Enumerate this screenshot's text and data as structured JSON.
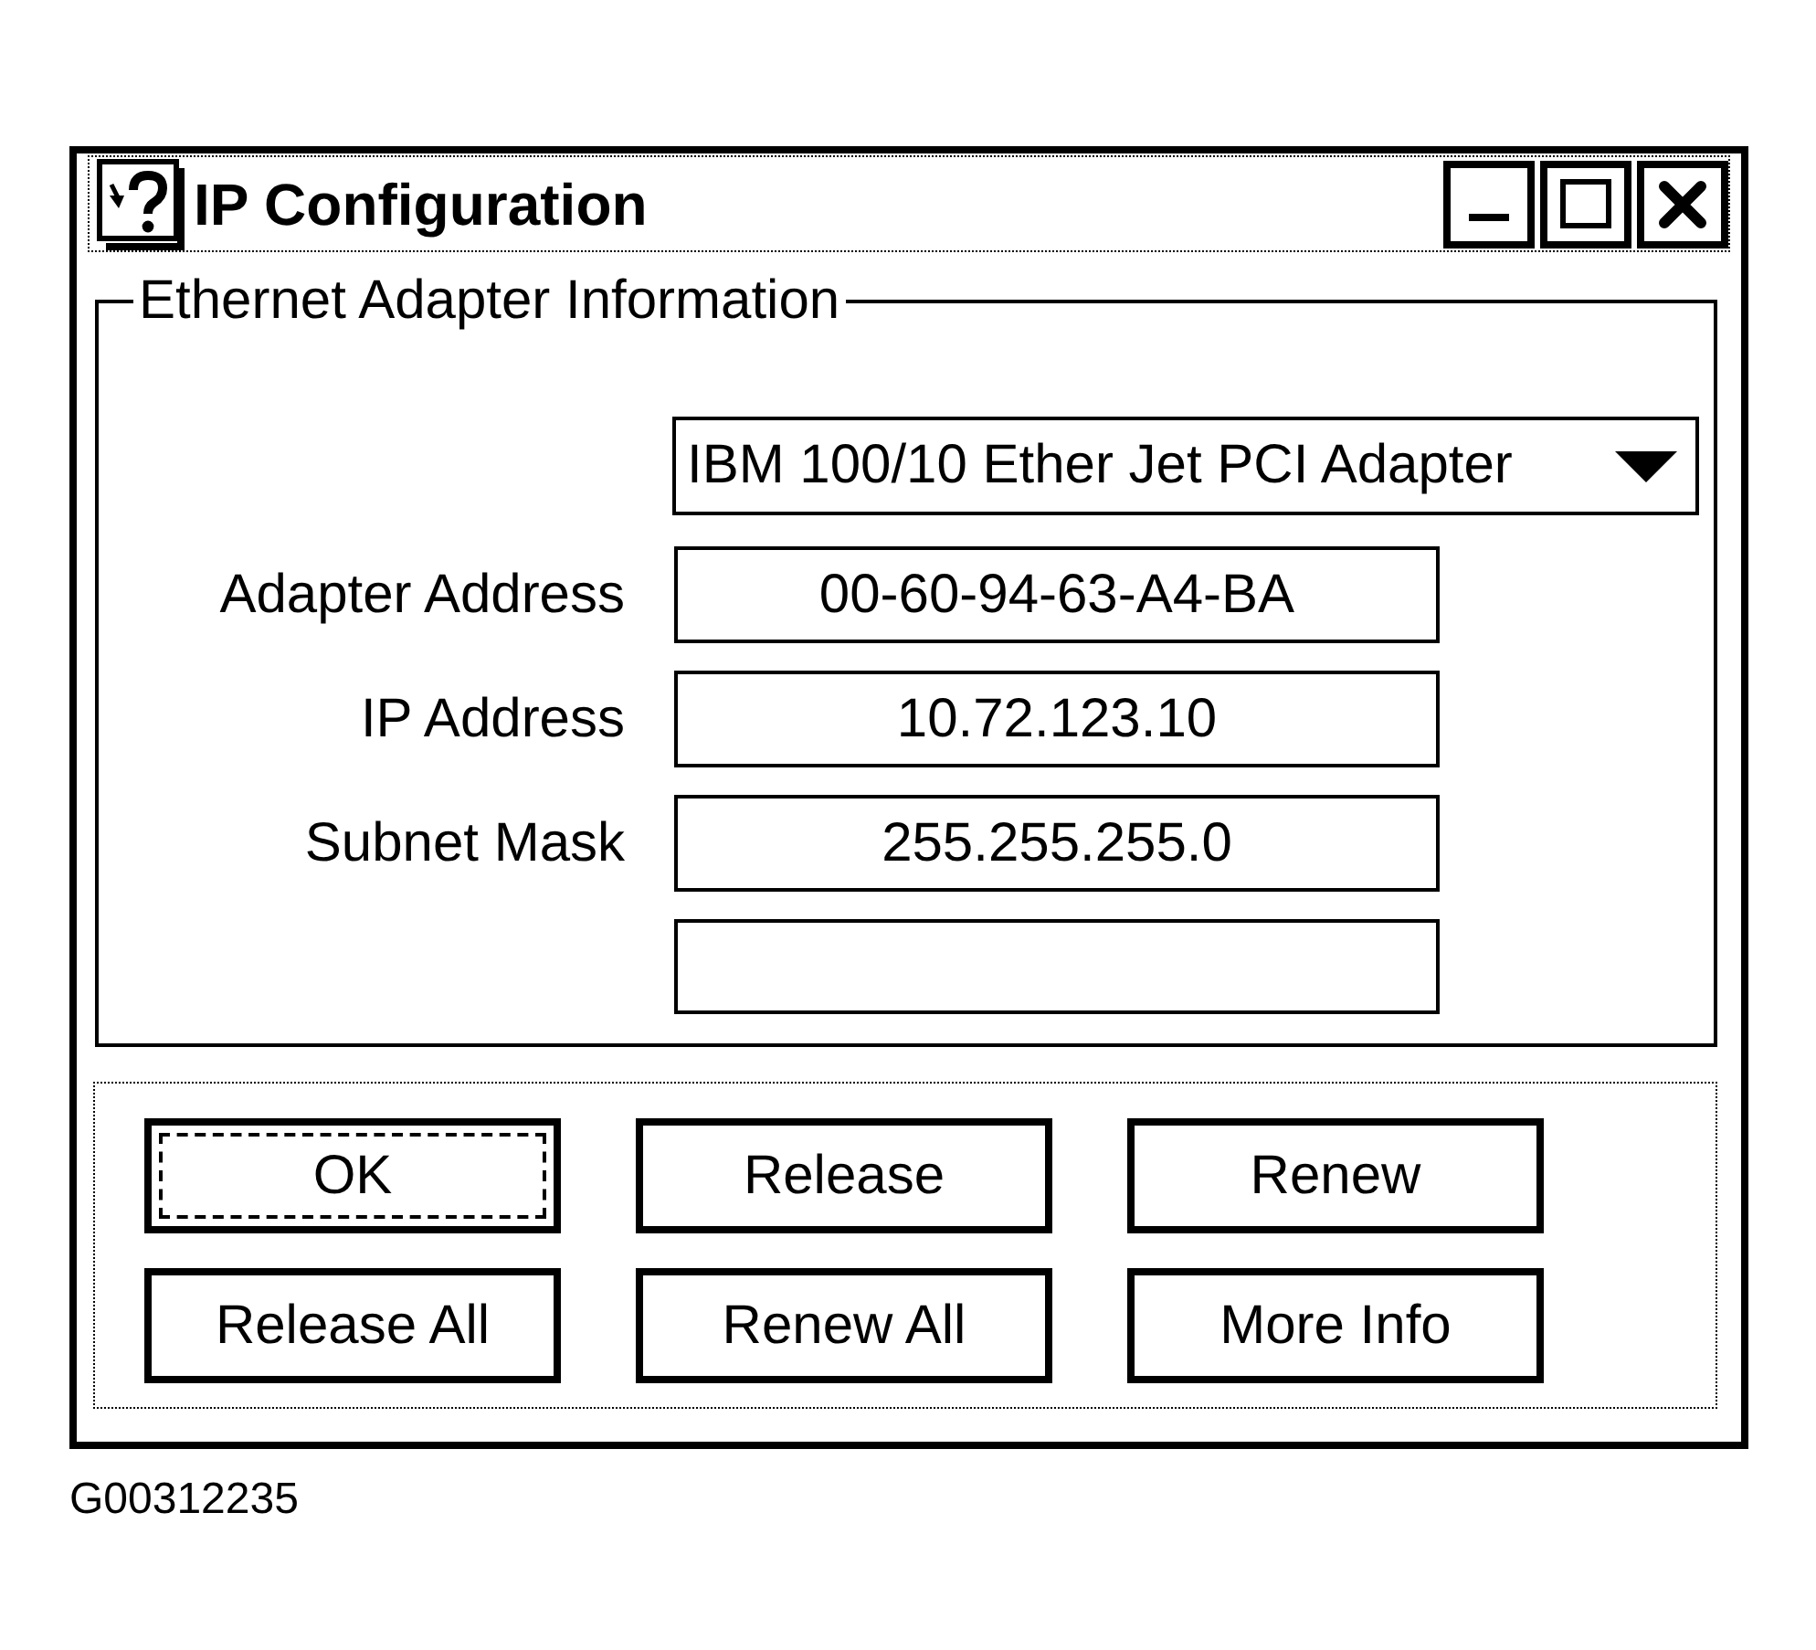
{
  "window": {
    "title": "IP Configuration",
    "controls": [
      {
        "kind": "minimize"
      },
      {
        "kind": "maximize"
      },
      {
        "kind": "close"
      }
    ]
  },
  "adapter_group": {
    "title": "Ethernet Adapter Information",
    "adapter_dropdown": {
      "value": "IBM 100/10 Ether Jet PCI Adapter"
    },
    "fields": [
      {
        "kind": "labeled",
        "label": "Adapter Address",
        "value": "00-60-94-63-A4-BA"
      },
      {
        "kind": "labeled",
        "label": "IP Address",
        "value": "10.72.123.10"
      },
      {
        "kind": "labeled",
        "label": "Subnet Mask",
        "value": "255.255.255.0"
      },
      {
        "kind": "blank"
      }
    ]
  },
  "buttons": [
    {
      "label": "OK",
      "focused": true
    },
    {
      "label": "Release",
      "focused": false
    },
    {
      "label": "Renew",
      "focused": false
    },
    {
      "label": "Release All",
      "focused": false
    },
    {
      "label": "Renew All",
      "focused": false
    },
    {
      "label": "More Info",
      "focused": false
    }
  ],
  "figure_id": "G00312235"
}
